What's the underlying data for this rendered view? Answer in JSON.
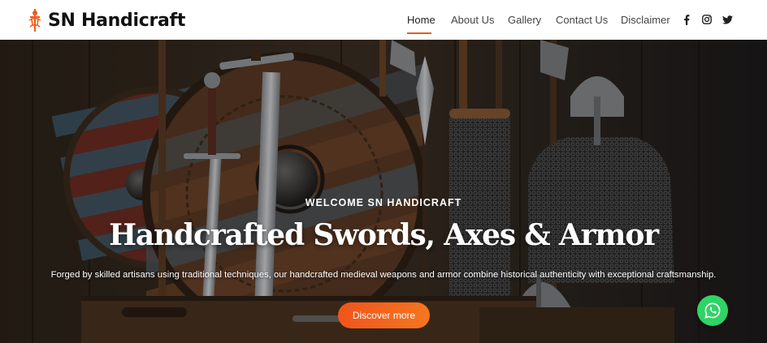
{
  "brand": {
    "name": "SN Handicraft",
    "logo_icon": "sword-figure-icon",
    "accent_color": "#f05a1a"
  },
  "nav": {
    "items": [
      {
        "label": "Home",
        "active": true
      },
      {
        "label": "About Us",
        "active": false
      },
      {
        "label": "Gallery",
        "active": false
      },
      {
        "label": "Contact Us",
        "active": false
      },
      {
        "label": "Disclaimer",
        "active": false
      }
    ],
    "social": [
      "facebook-icon",
      "instagram-icon",
      "twitter-icon"
    ]
  },
  "hero": {
    "eyebrow": "WELCOME SN HANDICRAFT",
    "headline": "Handcrafted Swords, Axes & Armor",
    "subtext": "Forged by skilled artisans using traditional techniques, our handcrafted medieval weapons and armor combine historical authenticity with exceptional craftsmanship.",
    "cta_label": "Discover more",
    "cta_color": "#f2541b",
    "chat_icon": "whatsapp-icon",
    "chat_color": "#2fd366"
  }
}
